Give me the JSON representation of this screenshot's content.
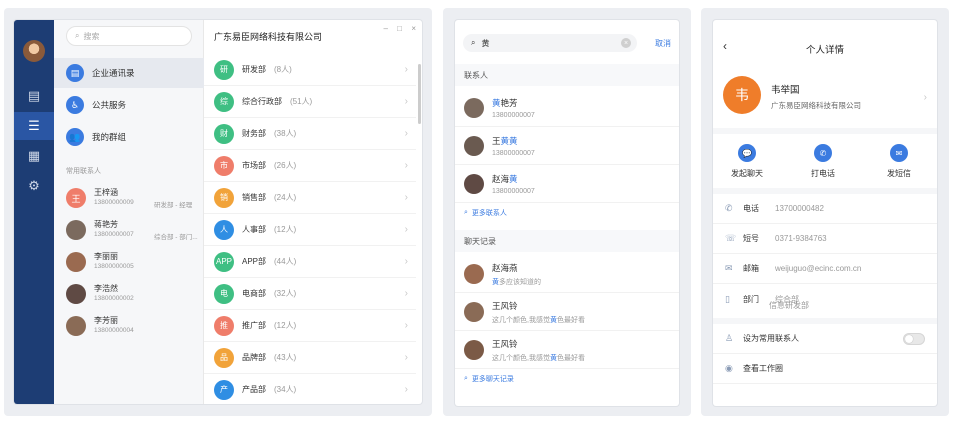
{
  "panel1": {
    "search_placeholder": "搜索",
    "company": "广东易臣网络科技有限公司",
    "window_controls": [
      "–",
      "□",
      "×"
    ],
    "nav_icons": [
      "chat-icon",
      "contacts-icon",
      "apps-icon",
      "settings-icon"
    ],
    "menu": [
      {
        "label": "企业通讯录",
        "glyph": "▤"
      },
      {
        "label": "公共服务",
        "glyph": "♿"
      },
      {
        "label": "我的群组",
        "glyph": "👥"
      }
    ],
    "frequent_label": "常用联系人",
    "contacts": [
      {
        "name": "王梓涵",
        "phone": "13800000009",
        "dept": "研发部 - 经理",
        "avatar_text": "王",
        "color": "#ef7d6a"
      },
      {
        "name": "蒋艳芳",
        "phone": "13800000007",
        "dept": "综合部 - 部门...",
        "avatar_text": "",
        "color": "#7b6a5e"
      },
      {
        "name": "李丽丽",
        "phone": "13800000005",
        "dept": "",
        "avatar_text": "",
        "color": "#9a6a50"
      },
      {
        "name": "李浩然",
        "phone": "13800000002",
        "dept": "",
        "avatar_text": "",
        "color": "#5f4a44"
      },
      {
        "name": "李芳丽",
        "phone": "13800000004",
        "dept": "",
        "avatar_text": "",
        "color": "#8a6b56"
      }
    ],
    "departments": [
      {
        "glyph": "研",
        "name": "研发部",
        "count": "(8人)",
        "color": "#3fbf83"
      },
      {
        "glyph": "综",
        "name": "综合行政部",
        "count": "(51人)",
        "color": "#3fbf83"
      },
      {
        "glyph": "财",
        "name": "财务部",
        "count": "(38人)",
        "color": "#3fbf83"
      },
      {
        "glyph": "市",
        "name": "市场部",
        "count": "(26人)",
        "color": "#ef7d6a"
      },
      {
        "glyph": "销",
        "name": "销售部",
        "count": "(24人)",
        "color": "#f1a33a"
      },
      {
        "glyph": "人",
        "name": "人事部",
        "count": "(12人)",
        "color": "#2f8ee3"
      },
      {
        "glyph": "APP",
        "name": "APP部",
        "count": "(44人)",
        "color": "#3fbf83"
      },
      {
        "glyph": "电",
        "name": "电商部",
        "count": "(32人)",
        "color": "#3fbf83"
      },
      {
        "glyph": "推",
        "name": "推广部",
        "count": "(12人)",
        "color": "#ef7d6a"
      },
      {
        "glyph": "品",
        "name": "品牌部",
        "count": "(43人)",
        "color": "#f1a33a"
      },
      {
        "glyph": "产",
        "name": "产品部",
        "count": "(34人)",
        "color": "#2f8ee3"
      }
    ]
  },
  "panel2": {
    "query": "黄",
    "cancel": "取消",
    "contacts_label": "联系人",
    "contacts": [
      {
        "pre": "",
        "hl": "黄",
        "post": "艳芳",
        "phone": "13800000007",
        "color": "#7b6a5e"
      },
      {
        "pre": "王",
        "hl": "黄黄",
        "post": "",
        "phone": "13800000007",
        "color": "#6a5a50"
      },
      {
        "pre": "赵海",
        "hl": "黄",
        "post": "",
        "phone": "13800000007",
        "color": "#5f4a44"
      }
    ],
    "more_contacts": "更多联系人",
    "chat_label": "聊天记录",
    "chats": [
      {
        "name": "赵海燕",
        "pre": "",
        "hl": "黄",
        "post": "多应该知道的",
        "color": "#9a6a50"
      },
      {
        "name": "王风铃",
        "pre": "这几个颜色,我感觉",
        "hl": "黄",
        "post": "色最好看",
        "color": "#8a6b56"
      },
      {
        "name": "王风铃",
        "pre": "这几个颜色,我感觉",
        "hl": "黄",
        "post": "色最好看",
        "color": "#7b5a46"
      }
    ],
    "more_chats": "更多聊天记录"
  },
  "panel3": {
    "title": "个人详情",
    "avatar_text": "韦",
    "name": "韦举国",
    "company": "广东易臣网络科技有限公司",
    "actions": [
      {
        "label": "发起聊天",
        "icon": "chat-bubble-icon",
        "glyph": "💬"
      },
      {
        "label": "打电话",
        "icon": "phone-icon",
        "glyph": "✆"
      },
      {
        "label": "发短信",
        "icon": "sms-icon",
        "glyph": "✉"
      }
    ],
    "fields": [
      {
        "icon": "phone-outline-icon",
        "glyph": "✆",
        "label": "电话",
        "value": "13700000482"
      },
      {
        "icon": "landline-icon",
        "glyph": "☏",
        "label": "短号",
        "value": "0371-9384763"
      },
      {
        "icon": "mail-icon",
        "glyph": "✉",
        "label": "邮箱",
        "value": "weijuguo@ecinc.com.cn"
      },
      {
        "icon": "document-icon",
        "glyph": "▯",
        "label": "部门",
        "value": "综合部"
      }
    ],
    "dept_extra": "信息研发部",
    "set_frequent": "设为常用联系人",
    "view_schedule": "查看工作圈"
  }
}
